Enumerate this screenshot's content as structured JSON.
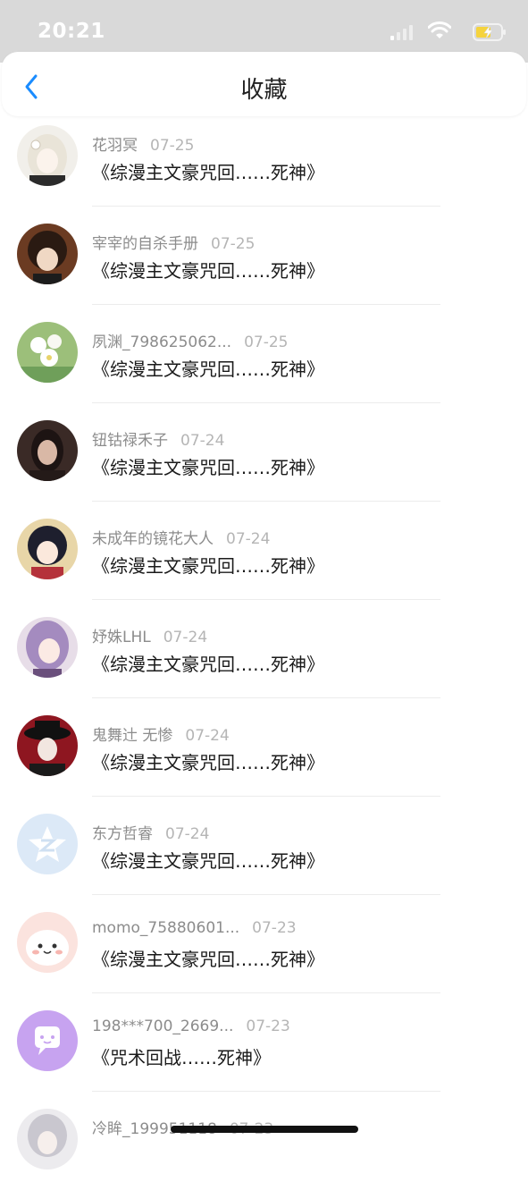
{
  "status_bar": {
    "time": "20:21",
    "icons": [
      "signal-icon",
      "wifi-icon",
      "battery-charging-icon"
    ]
  },
  "header": {
    "title": "收藏",
    "back_icon": "chevron-left-icon"
  },
  "colors": {
    "accent": "#1a8cff",
    "status_bar_bg": "#d9d9d9",
    "username_text": "#8c8c8c",
    "date_text": "#b5b5b5",
    "title_text": "#1a1a1a"
  },
  "items": [
    {
      "username": "花羽冥",
      "date": "07-25",
      "title": "《综漫主文豪咒回……死神》",
      "avatar": "anime-white-hair-avatar"
    },
    {
      "username": "宰宰的自杀手册",
      "date": "07-25",
      "title": "《综漫主文豪咒回……死神》",
      "avatar": "anime-dark-hair-avatar"
    },
    {
      "username": "夙渊_798625062...",
      "date": "07-25",
      "title": "《综漫主文豪咒回……死神》",
      "avatar": "flower-avatar"
    },
    {
      "username": "钮钴禄禾子",
      "date": "07-24",
      "title": "《综漫主文豪咒回……死神》",
      "avatar": "photo-person-avatar"
    },
    {
      "username": "未成年的镜花大人",
      "date": "07-24",
      "title": "《综漫主文豪咒回……死神》",
      "avatar": "anime-girl-avatar"
    },
    {
      "username": "妤姝LHL",
      "date": "07-24",
      "title": "《综漫主文豪咒回……死神》",
      "avatar": "anime-purple-hair-avatar"
    },
    {
      "username": "鬼舞辻 无惨",
      "date": "07-24",
      "title": "《综漫主文豪咒回……死神》",
      "avatar": "anime-hat-avatar"
    },
    {
      "username": "东方哲睿",
      "date": "07-24",
      "title": "《综漫主文豪咒回……死神》",
      "avatar": "qzone-default-avatar"
    },
    {
      "username": "momo_75880601...",
      "date": "07-23",
      "title": "《综漫主文豪咒回……死神》",
      "avatar": "pink-blob-avatar"
    },
    {
      "username": "198***700_2669...",
      "date": "07-23",
      "title": "《咒术回战……死神》",
      "avatar": "chat-bubble-avatar"
    },
    {
      "username": "冷眸_199951118",
      "date": "07-23",
      "title": "",
      "avatar": "anime-silver-hair-avatar"
    }
  ]
}
